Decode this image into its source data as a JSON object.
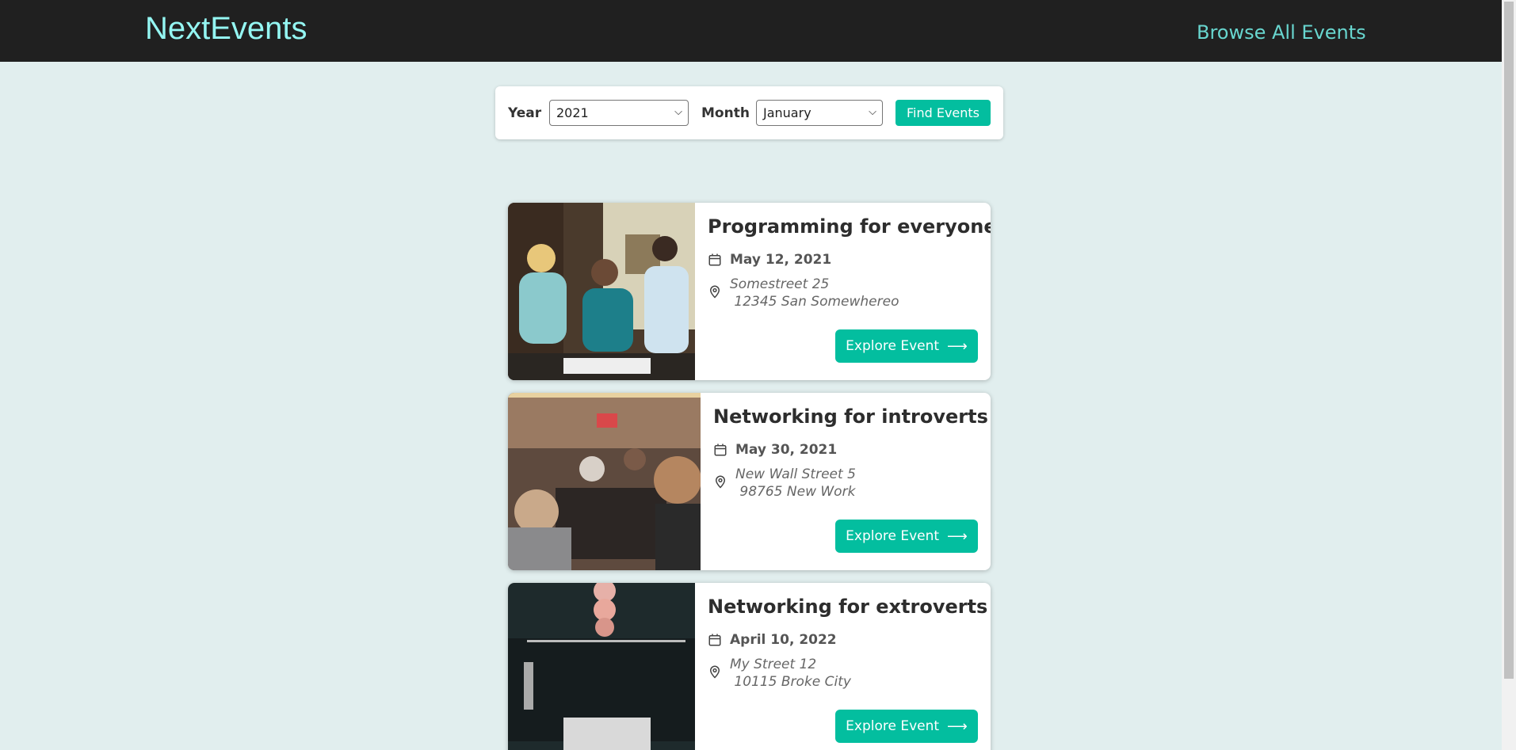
{
  "header": {
    "logo": "NextEvents",
    "nav_link": "Browse All Events"
  },
  "filter": {
    "year_label": "Year",
    "year_value": "2021",
    "month_label": "Month",
    "month_value": "January",
    "submit_label": "Find Events"
  },
  "events": [
    {
      "title": "Programming for everyone",
      "date": "May 12, 2021",
      "address": "Somestreet 25\n 12345 San Somewhereo",
      "button": "Explore Event"
    },
    {
      "title": "Networking for introverts",
      "date": "May 30, 2021",
      "address": "New Wall Street 5\n 98765 New Work",
      "button": "Explore Event"
    },
    {
      "title": "Networking for extroverts",
      "date": "April 10, 2022",
      "address": "My Street 12\n 10115 Broke City",
      "button": "Explore Event"
    }
  ],
  "colors": {
    "header_bg": "#202020",
    "logo": "#94f6f2",
    "nav_link": "#68d6cf",
    "page_bg": "#e1eeee",
    "accent": "#03be9f"
  },
  "icons": {
    "date": "calendar-icon",
    "address": "location-pin-icon",
    "button": "arrow-right-icon"
  }
}
